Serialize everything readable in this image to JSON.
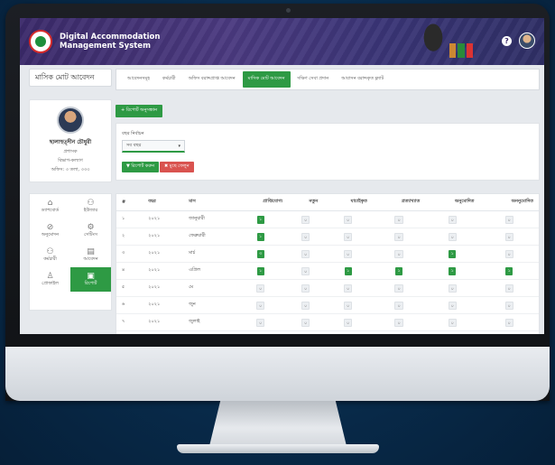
{
  "app": {
    "title_line1": "Digital Accommodation",
    "title_line2": "Management System",
    "help": "?"
  },
  "page_title": "মাসিক মোট আবেদন",
  "profile": {
    "name": "ছালাহুত্দীন চৌধুরী",
    "line1": "প্রশাসক",
    "line2": "বিভাগ-কল্যাণ",
    "line3": "অফিস: ৩ তলা, ৩৩৩"
  },
  "nav": [
    {
      "label": "ড্যাশবোর্ড",
      "icon": "home-icon",
      "glyph": "⌂",
      "active": false
    },
    {
      "label": "ইউজার",
      "icon": "users-icon",
      "glyph": "⚇",
      "active": false
    },
    {
      "label": "অনুমোদন",
      "icon": "check-icon",
      "glyph": "⊘",
      "active": false
    },
    {
      "label": "সেটিংস",
      "icon": "gear-icon",
      "glyph": "⚙",
      "active": false
    },
    {
      "label": "কর্মচারী",
      "icon": "staff-icon",
      "glyph": "⚇",
      "active": false
    },
    {
      "label": "আবেদন",
      "icon": "form-icon",
      "glyph": "▤",
      "active": false
    },
    {
      "label": "প্রোফাইল",
      "icon": "user-icon",
      "glyph": "♙",
      "active": false
    },
    {
      "label": "রিপোর্ট",
      "icon": "report-icon",
      "glyph": "▣",
      "active": true
    }
  ],
  "tabs": [
    {
      "label": "আবেদনসমূহ",
      "active": false
    },
    {
      "label": "কর্মচারী",
      "active": false
    },
    {
      "label": "অফিস বরাদ্দপ্রাপ্ত আবেদন",
      "active": false
    },
    {
      "label": "মাসিক মোট আবেদন",
      "active": true
    },
    {
      "label": "দক্ষিণ সেবা প্রদান",
      "active": false
    },
    {
      "label": "আবাসন বরাদ্দকৃত ফ্ল্যাট",
      "active": false
    }
  ],
  "add_button": "+ রিপোর্ট অনুসন্ধান",
  "filter": {
    "label": "বছর নির্বাচন",
    "selected": "সব বছর",
    "search_label": "▼ রিপোর্ট করুন",
    "clear_label": "✖ মুছে ফেলুন"
  },
  "table": {
    "headers": [
      "#",
      "বছর",
      "মাস",
      "প্রাপ্তিযোগ্য",
      "নতুন",
      "যাচাইকৃত",
      "প্রত্যাখ্যাত",
      "অনুমোদিত",
      "অননুমোদিত"
    ],
    "rows": [
      {
        "no": "১",
        "year": "২০২১",
        "month": "জানুয়ারী",
        "vals": [
          {
            "v": "১",
            "g": true
          },
          {
            "v": "০",
            "g": false
          },
          {
            "v": "০",
            "g": false
          },
          {
            "v": "০",
            "g": false
          },
          {
            "v": "০",
            "g": false
          },
          {
            "v": "০",
            "g": false
          }
        ]
      },
      {
        "no": "২",
        "year": "২০২১",
        "month": "ফেব্রুয়ারী",
        "vals": [
          {
            "v": "১",
            "g": true
          },
          {
            "v": "০",
            "g": false
          },
          {
            "v": "০",
            "g": false
          },
          {
            "v": "০",
            "g": false
          },
          {
            "v": "০",
            "g": false
          },
          {
            "v": "০",
            "g": false
          }
        ]
      },
      {
        "no": "৩",
        "year": "২০২১",
        "month": "মার্চ",
        "vals": [
          {
            "v": "৩",
            "g": true
          },
          {
            "v": "০",
            "g": false
          },
          {
            "v": "০",
            "g": false
          },
          {
            "v": "০",
            "g": false
          },
          {
            "v": "১",
            "g": true
          },
          {
            "v": "০",
            "g": false
          }
        ]
      },
      {
        "no": "৪",
        "year": "২০২১",
        "month": "এপ্রিল",
        "vals": [
          {
            "v": "১",
            "g": true
          },
          {
            "v": "০",
            "g": false
          },
          {
            "v": "১",
            "g": true
          },
          {
            "v": "১",
            "g": true
          },
          {
            "v": "১",
            "g": true
          },
          {
            "v": "১",
            "g": true
          }
        ]
      },
      {
        "no": "৫",
        "year": "২০২১",
        "month": "মে",
        "vals": [
          {
            "v": "০",
            "g": false
          },
          {
            "v": "০",
            "g": false
          },
          {
            "v": "০",
            "g": false
          },
          {
            "v": "০",
            "g": false
          },
          {
            "v": "০",
            "g": false
          },
          {
            "v": "০",
            "g": false
          }
        ]
      },
      {
        "no": "৬",
        "year": "২০২১",
        "month": "জুন",
        "vals": [
          {
            "v": "০",
            "g": false
          },
          {
            "v": "০",
            "g": false
          },
          {
            "v": "০",
            "g": false
          },
          {
            "v": "০",
            "g": false
          },
          {
            "v": "০",
            "g": false
          },
          {
            "v": "০",
            "g": false
          }
        ]
      },
      {
        "no": "৭",
        "year": "২০২১",
        "month": "জুলাই",
        "vals": [
          {
            "v": "০",
            "g": false
          },
          {
            "v": "০",
            "g": false
          },
          {
            "v": "০",
            "g": false
          },
          {
            "v": "০",
            "g": false
          },
          {
            "v": "০",
            "g": false
          },
          {
            "v": "০",
            "g": false
          }
        ]
      }
    ]
  },
  "colors": {
    "accent": "#2e9a44",
    "danger": "#d9534f",
    "header": "#3b2a6a"
  }
}
